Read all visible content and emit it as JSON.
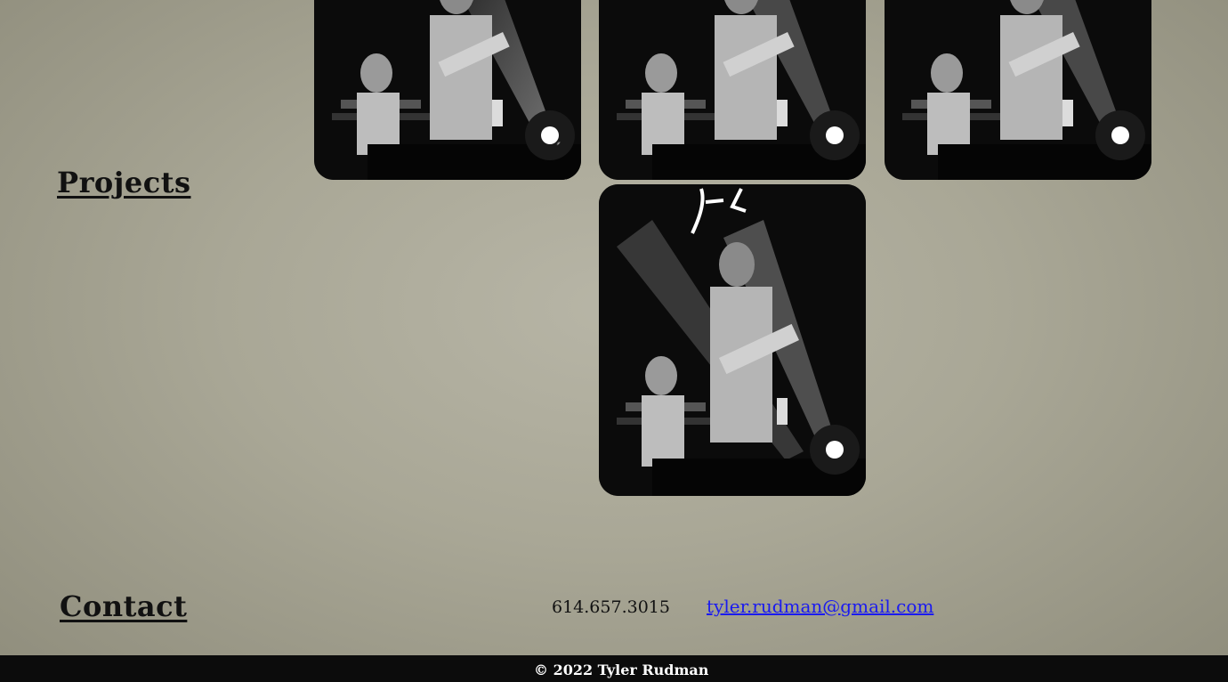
{
  "projects": {
    "heading": "Projects",
    "photos": [
      {
        "alt": "Concert photo",
        "icon": "photo-image"
      },
      {
        "alt": "Concert photo",
        "icon": "photo-image"
      },
      {
        "alt": "Concert photo",
        "icon": "photo-image"
      },
      {
        "alt": "Concert photo",
        "icon": "photo-image"
      }
    ]
  },
  "contact": {
    "heading": "Contact",
    "phone": "614.657.3015",
    "email": "tyler.rudman@gmail.com"
  },
  "footer": {
    "copyright": "© 2022 Tyler Rudman"
  },
  "colors": {
    "link": "#1a1af0",
    "footer_bg": "#0c0c0c",
    "page_bg": "#a9a796"
  }
}
